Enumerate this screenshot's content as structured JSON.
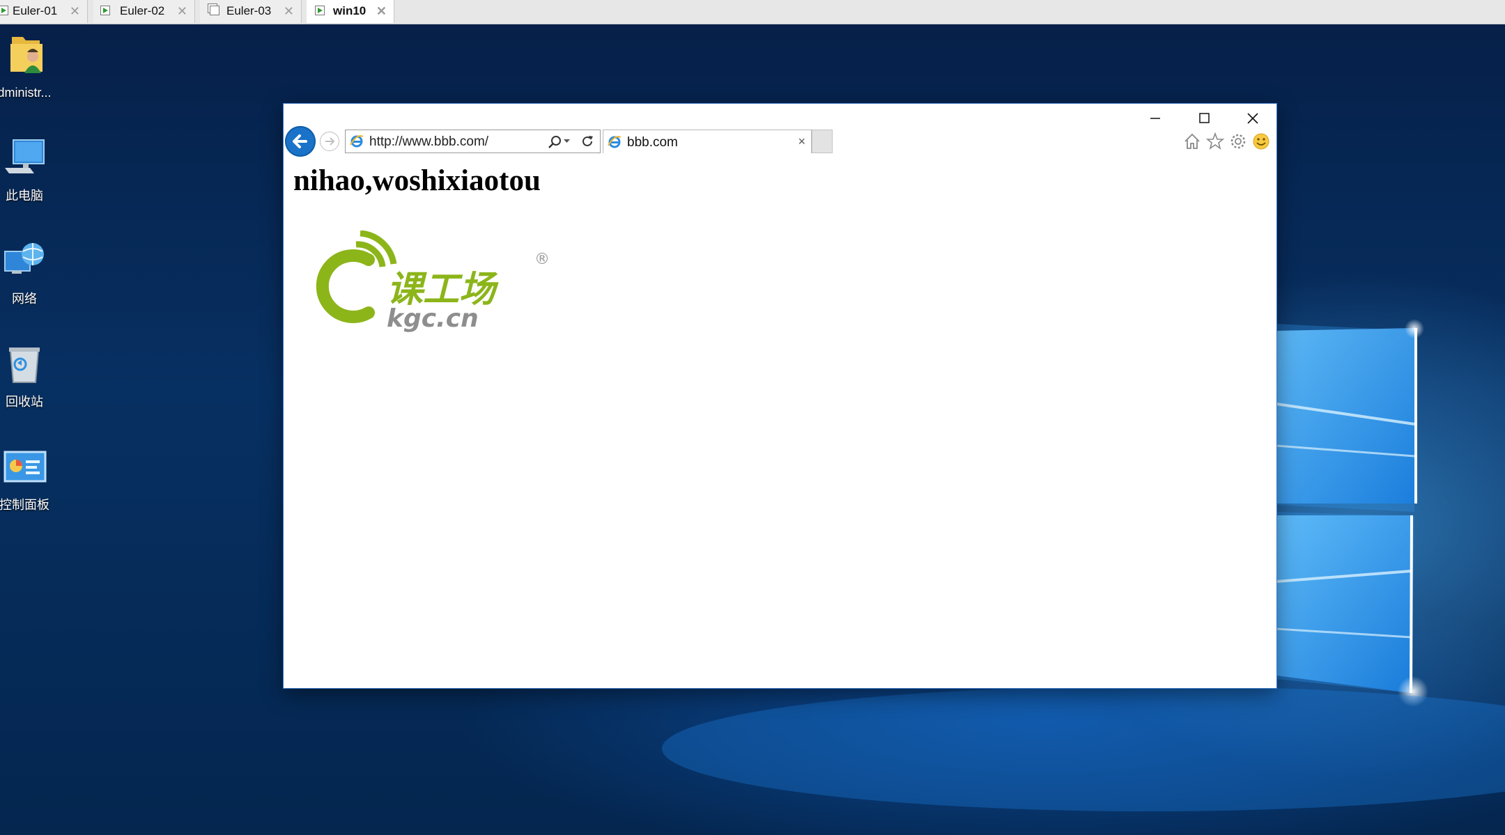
{
  "vm_tabs": [
    {
      "label": "Euler-01",
      "close": "✕",
      "running": true
    },
    {
      "label": "Euler-02",
      "close": "✕",
      "running": true
    },
    {
      "label": "Euler-03",
      "close": "✕",
      "running": false
    },
    {
      "label": "win10",
      "close": "✕",
      "running": true,
      "active": true
    }
  ],
  "desktop_icons": [
    {
      "label": "dministr...",
      "icon": "user-folder-icon"
    },
    {
      "label": "此电脑",
      "icon": "computer-icon"
    },
    {
      "label": "网络",
      "icon": "network-icon"
    },
    {
      "label": "回收站",
      "icon": "recycle-bin-icon"
    },
    {
      "label": "控制面板",
      "icon": "control-panel-icon"
    }
  ],
  "browser": {
    "address": "http://www.bbb.com/",
    "tab_title": "bbb.com",
    "tab_close": "×",
    "toolbar_icons": [
      "home-icon",
      "favorites-star-icon",
      "settings-gear-icon",
      "feedback-smiley-icon"
    ],
    "caption_buttons": [
      "minimize-icon",
      "maximize-icon",
      "close-icon"
    ]
  },
  "page": {
    "heading": "nihao,woshixiaotou",
    "logo": {
      "cn_text": "课工场",
      "domain_text": "kgc.cn",
      "registered_mark": "®",
      "brand_color": "#8cb51a"
    }
  },
  "colors": {
    "desktop_dark": "#062049",
    "ie_blue": "#1a73c8",
    "tabbar": "#e7e7e7"
  }
}
